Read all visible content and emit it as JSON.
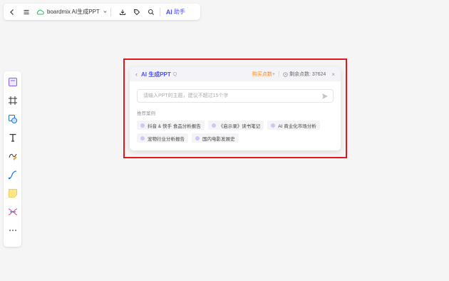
{
  "toolbar": {
    "back_icon": "chevron-left-icon",
    "menu_icon": "menu-icon",
    "cloud_icon": "cloud-icon",
    "file_name": "boardmix AI生成PPT",
    "download_icon": "download-icon",
    "tag_icon": "tag-icon",
    "search_icon": "search-icon",
    "ai_mark": "AI",
    "ai_label": "助手"
  },
  "left_tools": [
    "sticky-template-icon",
    "frame-icon",
    "shape-icon",
    "text-icon",
    "pen-icon",
    "connector-icon",
    "sticky-note-icon",
    "mindmap-icon",
    "more-icon"
  ],
  "dialog": {
    "back": "‹",
    "title": "AI 生成PPT",
    "info": "Q",
    "buy_label": "购买点数",
    "buy_plus": "+",
    "remain_label": "剩余点数: 37624",
    "close": "×",
    "input_placeholder": "请输入PPT的主题，建议不超过15个字",
    "input_value": "",
    "recommend_label": "推荐案例",
    "chips": [
      "抖音 & 快手 食品分析报告",
      "《启示录》读书笔记",
      "AI 商业化市场分析",
      "宠物行业分析报告",
      "国内电影发展史"
    ]
  },
  "colors": {
    "accent": "#4a4dff",
    "buy": "#f08a24",
    "highlight": "#e0191e"
  }
}
